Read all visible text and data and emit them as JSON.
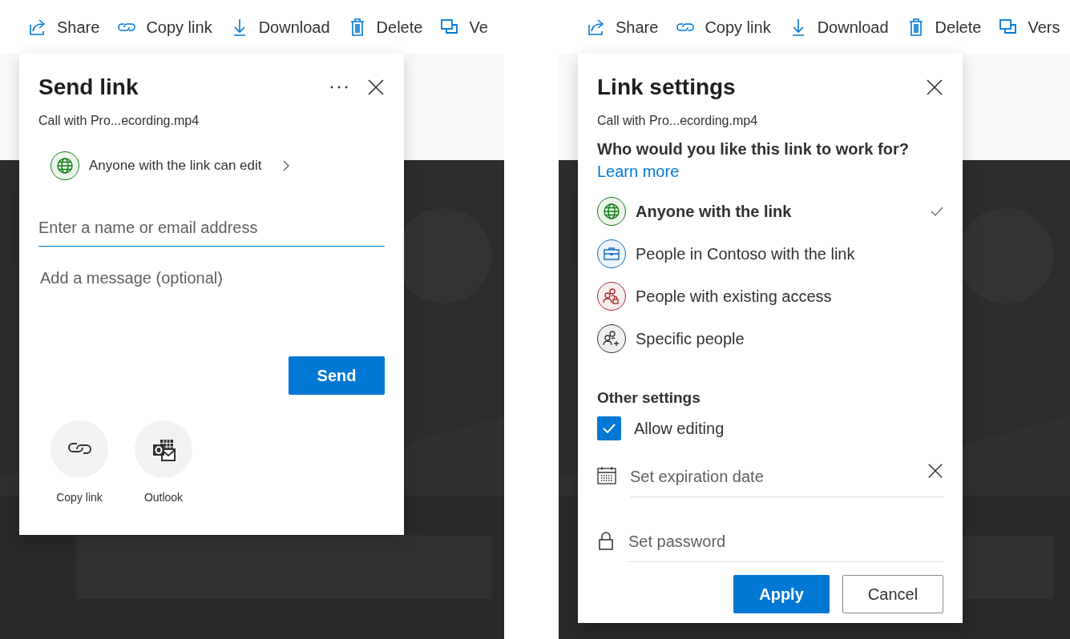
{
  "left_pane": {
    "toolbar": [
      {
        "kind": "share",
        "label": "Share"
      },
      {
        "kind": "link",
        "label": "Copy link"
      },
      {
        "kind": "download",
        "label": "Download"
      },
      {
        "kind": "delete",
        "label": "Delete"
      },
      {
        "kind": "versions",
        "label": "Ve"
      }
    ],
    "send_link_dialog": {
      "title": "Send link",
      "file_name": "Call with Pro...ecording.mp4",
      "permission": "Anyone with the link can edit",
      "recipient": {
        "placeholder": "Enter a name or email address"
      },
      "message": {
        "placeholder": "Add a message (optional)"
      },
      "send_button": "Send",
      "share_options": [
        {
          "kind": "link",
          "label": "Copy link"
        },
        {
          "kind": "outlook",
          "label": "Outlook"
        }
      ]
    }
  },
  "right_pane": {
    "toolbar": [
      {
        "kind": "share",
        "label": "Share"
      },
      {
        "kind": "link",
        "label": "Copy link"
      },
      {
        "kind": "download",
        "label": "Download"
      },
      {
        "kind": "delete",
        "label": "Delete"
      },
      {
        "kind": "versions",
        "label": "Vers"
      }
    ],
    "link_settings_dialog": {
      "title": "Link settings",
      "file_name": "Call with Pro...ecording.mp4",
      "question": "Who would you like this link to work for?",
      "learn_more": "Learn more",
      "audience_options": [
        {
          "kind": "globe",
          "label": "Anyone with the link",
          "color": "#107c10",
          "selected": true
        },
        {
          "kind": "briefcase",
          "label": "People in Contoso with the link",
          "color": "#0f6cbd",
          "selected": false
        },
        {
          "kind": "people_lock",
          "label": "People with existing access",
          "color": "#a4262c",
          "selected": false
        },
        {
          "kind": "people_add",
          "label": "Specific people",
          "color": "#323130",
          "selected": false
        }
      ],
      "other_settings_heading": "Other settings",
      "allow_editing": {
        "label": "Allow editing",
        "checked": true
      },
      "expiration": {
        "placeholder": "Set expiration date"
      },
      "password": {
        "placeholder": "Set password"
      },
      "apply_button": "Apply",
      "cancel_button": "Cancel"
    }
  }
}
